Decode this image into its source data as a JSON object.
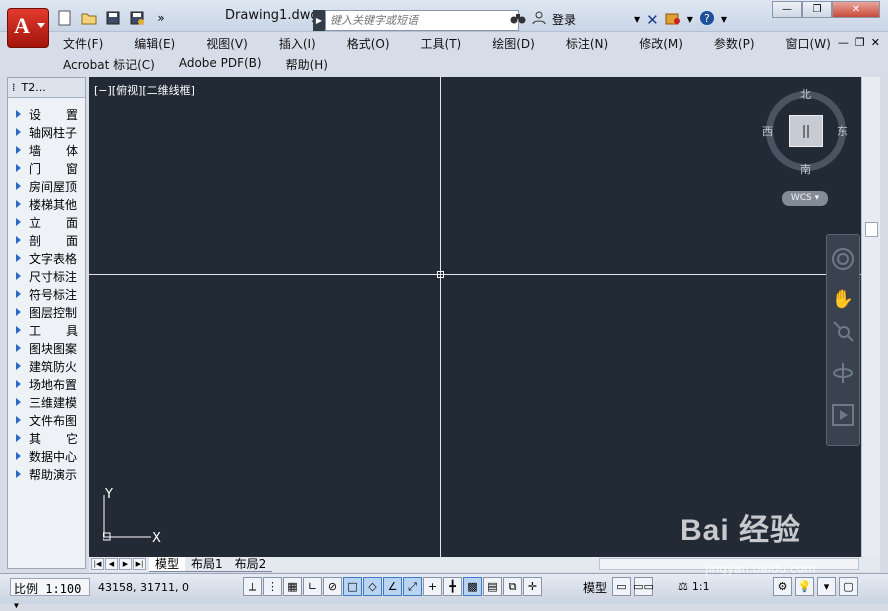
{
  "window": {
    "document_title": "Drawing1.dwg",
    "search_placeholder": "键入关键字或短语",
    "login_label": "登录",
    "minimize": "—",
    "restore": "❐",
    "close": "✕"
  },
  "menu": {
    "row1": [
      "文件(F)",
      "编辑(E)",
      "视图(V)",
      "插入(I)",
      "格式(O)",
      "工具(T)",
      "绘图(D)",
      "标注(N)",
      "修改(M)",
      "参数(P)",
      "窗口(W)"
    ],
    "row2": [
      "Acrobat 标记(C)",
      "Adobe PDF(B)",
      "帮助(H)"
    ]
  },
  "palette": {
    "title": "T2...",
    "items": [
      {
        "label": "设　置",
        "spread": true
      },
      {
        "label": "轴网柱子",
        "spread": false
      },
      {
        "label": "墙　体",
        "spread": true
      },
      {
        "label": "门　窗",
        "spread": true
      },
      {
        "label": "房间屋顶",
        "spread": false
      },
      {
        "label": "楼梯其他",
        "spread": false
      },
      {
        "label": "立　面",
        "spread": true
      },
      {
        "label": "剖　面",
        "spread": true
      },
      {
        "label": "文字表格",
        "spread": false
      },
      {
        "label": "尺寸标注",
        "spread": false
      },
      {
        "label": "符号标注",
        "spread": false
      },
      {
        "label": "图层控制",
        "spread": false
      },
      {
        "label": "工　具",
        "spread": true
      },
      {
        "label": "图块图案",
        "spread": false
      },
      {
        "label": "建筑防火",
        "spread": false
      },
      {
        "label": "场地布置",
        "spread": false
      },
      {
        "label": "三维建模",
        "spread": false
      },
      {
        "label": "文件布图",
        "spread": false
      },
      {
        "label": "其　它",
        "spread": true
      },
      {
        "label": "数据中心",
        "spread": false
      },
      {
        "label": "帮助演示",
        "spread": false
      }
    ]
  },
  "viewport": {
    "label": "[−][俯视][二维线框]",
    "compass": {
      "north": "北",
      "south": "南",
      "east": "东",
      "west": "西"
    },
    "wcs": "WCS",
    "ucs_x": "X",
    "ucs_y": "Y"
  },
  "tabs": [
    "模型",
    "布局1",
    "布局2"
  ],
  "status": {
    "scale": "比例 1:100",
    "coordinates": "43158,  31711, 0",
    "model": "模型",
    "annotation_scale": "1:1"
  },
  "watermark": {
    "text": "Bai 经验",
    "sub": "jingyan.baidu.com"
  }
}
